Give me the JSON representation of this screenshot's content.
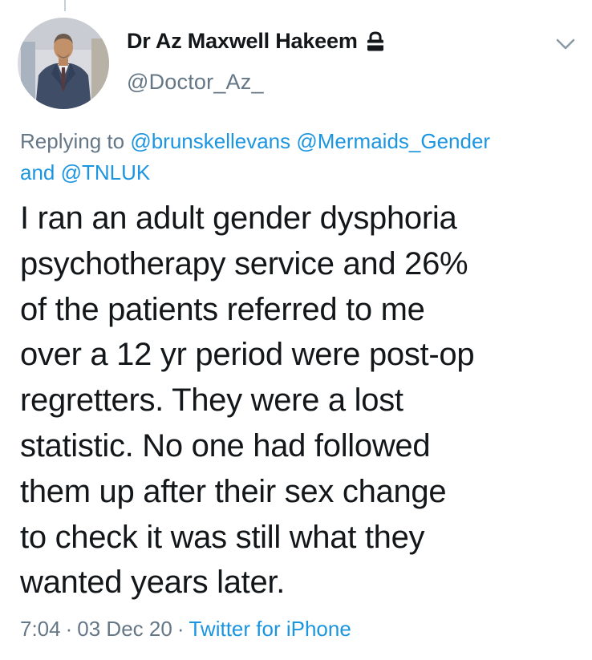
{
  "author": {
    "name": "Dr Az Maxwell Hakeem",
    "handle": "@Doctor_Az_",
    "protected_icon": "lock-icon"
  },
  "menu_icon": "chevron-down-icon",
  "reply_context": {
    "prefix": "Replying to",
    "mentions": [
      "@brunskellevans",
      "@Mermaids_Gender",
      "@TNLUK"
    ],
    "conjunction": "and"
  },
  "tweet_text_lines": [
    "I ran an adult gender dysphoria",
    "psychotherapy service and 26%",
    "of the patients referred to me",
    "over a 12 yr period were post-op",
    "regretters. They were a lost",
    "statistic. No one had followed",
    "them up after their sex change",
    "to check it was still what they",
    "wanted years later."
  ],
  "meta": {
    "time": "7:04",
    "date": "03 Dec 20",
    "separator": "·",
    "source": "Twitter for iPhone"
  },
  "colors": {
    "text_primary": "#14171a",
    "text_secondary": "#657786",
    "link": "#1b95e0",
    "thread_line": "#c4cfd6"
  }
}
